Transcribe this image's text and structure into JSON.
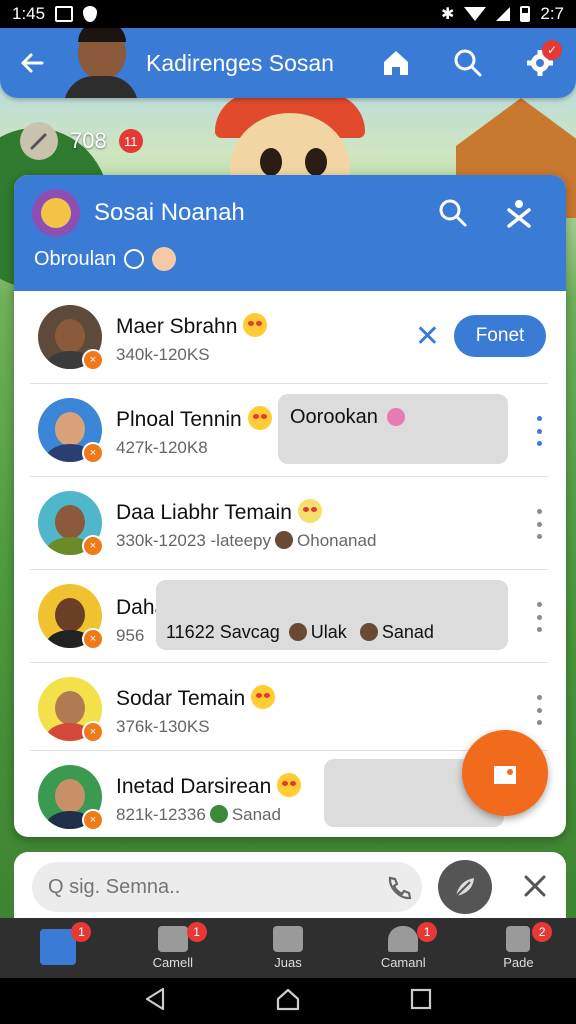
{
  "status_bar": {
    "time": "1:45",
    "right_text": "2:7"
  },
  "appbar": {
    "title": "Kadirenges Sosan"
  },
  "count": {
    "value": "708",
    "badge": "11"
  },
  "panel": {
    "title": "Sosai Noanah",
    "subtitle": "Obroulan"
  },
  "contacts": [
    {
      "name": "Maer Sbrahn",
      "meta": "340k-120KS",
      "button": "Fonet"
    },
    {
      "name": "Plnoal Tennin",
      "meta": "427k-120K8",
      "bubble": "Oorookan"
    },
    {
      "name": "Daa Liabhr Temain",
      "meta": "330k-12023 -lateepy",
      "meta_extra": "Ohonanad"
    },
    {
      "name": "Dahat Temán",
      "meta": "956",
      "bubble_parts": [
        "11622 Savcag",
        "Ulak",
        "Sanad"
      ]
    },
    {
      "name": "Sodar Temain",
      "meta": "376k-130KS"
    },
    {
      "name": "Inetad Darsirean",
      "meta": "821k-12336",
      "meta_extra": "Sanad"
    }
  ],
  "composer": {
    "placeholder": "Q sig. Semna.."
  },
  "bottom_nav": [
    {
      "label": "",
      "badge": "1",
      "active": true
    },
    {
      "label": "Camell",
      "badge": "1"
    },
    {
      "label": "Juas",
      "badge": ""
    },
    {
      "label": "Camanl",
      "badge": "1"
    },
    {
      "label": "Pade",
      "badge": "2"
    }
  ],
  "colors": {
    "primary": "#3a7bd5",
    "accent": "#f26b1d",
    "badge": "#e53935"
  }
}
